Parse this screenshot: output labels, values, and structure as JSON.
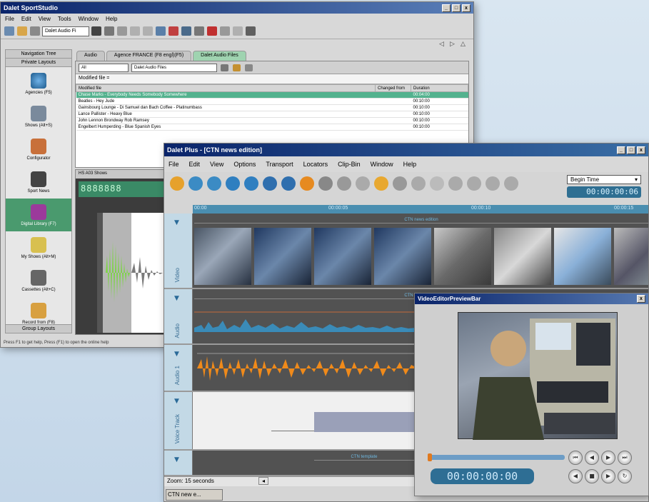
{
  "windowA": {
    "title": "Dalet SportStudio",
    "menu": [
      "File",
      "Edit",
      "View",
      "Tools",
      "Window",
      "Help"
    ],
    "combo_value": "Dalet Audio Fi",
    "left_panel": {
      "top_tabs": [
        "Navigation Tree",
        "Private Layouts"
      ],
      "items": [
        "Agencies (F5)",
        "Shows (Alt+S)",
        "Configurator",
        "Sport News",
        "Digital Library (F7)",
        "My Shows (Alt+M)",
        "Cassettes (Alt+C)",
        "Record from (F8)",
        ""
      ],
      "selected_index": 4,
      "bottom_label": "Group Layouts"
    },
    "tabs": [
      "Audio",
      "Agence FRANCE (F8 engl)(F5)",
      "Dalet Audio Files"
    ],
    "active_tab": 2,
    "filter_all": "All",
    "filter_files": "Dalet Audio Files",
    "filter_label": "Modified file =",
    "table": {
      "columns": [
        "Modified file",
        "Changed from",
        "Duration"
      ],
      "rows": [
        [
          "Chase Marks - Everybody Needs Somebody Somewhere",
          "",
          "00:04:00"
        ],
        [
          "Beatles - Hey Jude",
          "",
          "00:10:00"
        ],
        [
          "Gainsbourg Lounge - Di Samuel dan Bach Coffee - Platinumbass",
          "",
          "00:10:00"
        ],
        [
          "Lance Pallister - Heavy Blue",
          "",
          "00:10:00"
        ],
        [
          "John Lennon Brondway Rob Ramsey",
          "",
          "00:10:00"
        ],
        [
          "Engelbert Humperding - Blue Spanish Eyes",
          "",
          "00:10:00"
        ]
      ],
      "selected_row": 0
    },
    "audio_caption": "HS A03 Shows",
    "status": "Press F1 to get help, Press (F1) to open the online help"
  },
  "windowB": {
    "title": "Dalet Plus - [CTN news edition]",
    "menu": [
      "File",
      "Edit",
      "View",
      "Options",
      "Transport",
      "Locators",
      "Clip-Bin",
      "Window",
      "Help"
    ],
    "time_mode": "Begin Time",
    "timecode": "00:00:00:06",
    "ruler": [
      "00:00",
      "00:00:05",
      "00:00:10",
      "00:00:15"
    ],
    "tracks": [
      {
        "name": "Video",
        "label": "CTN news edition"
      },
      {
        "name": "Audio",
        "label": "CTN news edition"
      },
      {
        "name": "Audio 1",
        "label": ""
      },
      {
        "name": "Voice Track",
        "label": ""
      },
      {
        "name": "",
        "label": "CTN template"
      }
    ],
    "zoom": "Zoom: 15 seconds",
    "taskbar_button": "CTN new e..."
  },
  "preview": {
    "title": "VideoEditorPreviewBar",
    "timecode": "00:00:00:00",
    "progress": 0.0
  },
  "colors": {
    "accent_green": "#4a9a6e",
    "timeline_blue": "#4a8eb0",
    "waveform_orange": "#f08a1a",
    "waveform_blue": "#3a8bb8"
  }
}
